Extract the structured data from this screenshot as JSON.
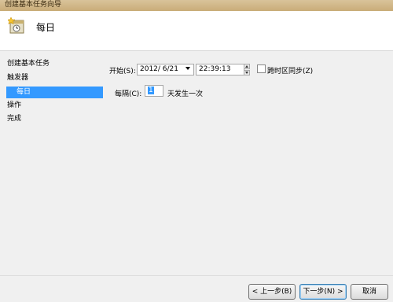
{
  "window": {
    "title": "创建基本任务向导"
  },
  "header": {
    "title": "每日"
  },
  "nav": {
    "items": [
      {
        "label": "创建基本任务"
      },
      {
        "label": "触发器"
      },
      {
        "label": "每日"
      },
      {
        "label": "操作"
      },
      {
        "label": "完成"
      }
    ]
  },
  "form": {
    "start_label": "开始(S):",
    "start_date": "2012/  6/21",
    "start_time": "22:39:13",
    "sync_label": "跨时区同步(Z)",
    "sync_checked": false,
    "recur_label": "每隔(C):",
    "recur_value": "1",
    "recur_suffix": "天发生一次"
  },
  "buttons": {
    "back": "< 上一步(B)",
    "next": "下一步(N) >",
    "cancel": "取消"
  }
}
